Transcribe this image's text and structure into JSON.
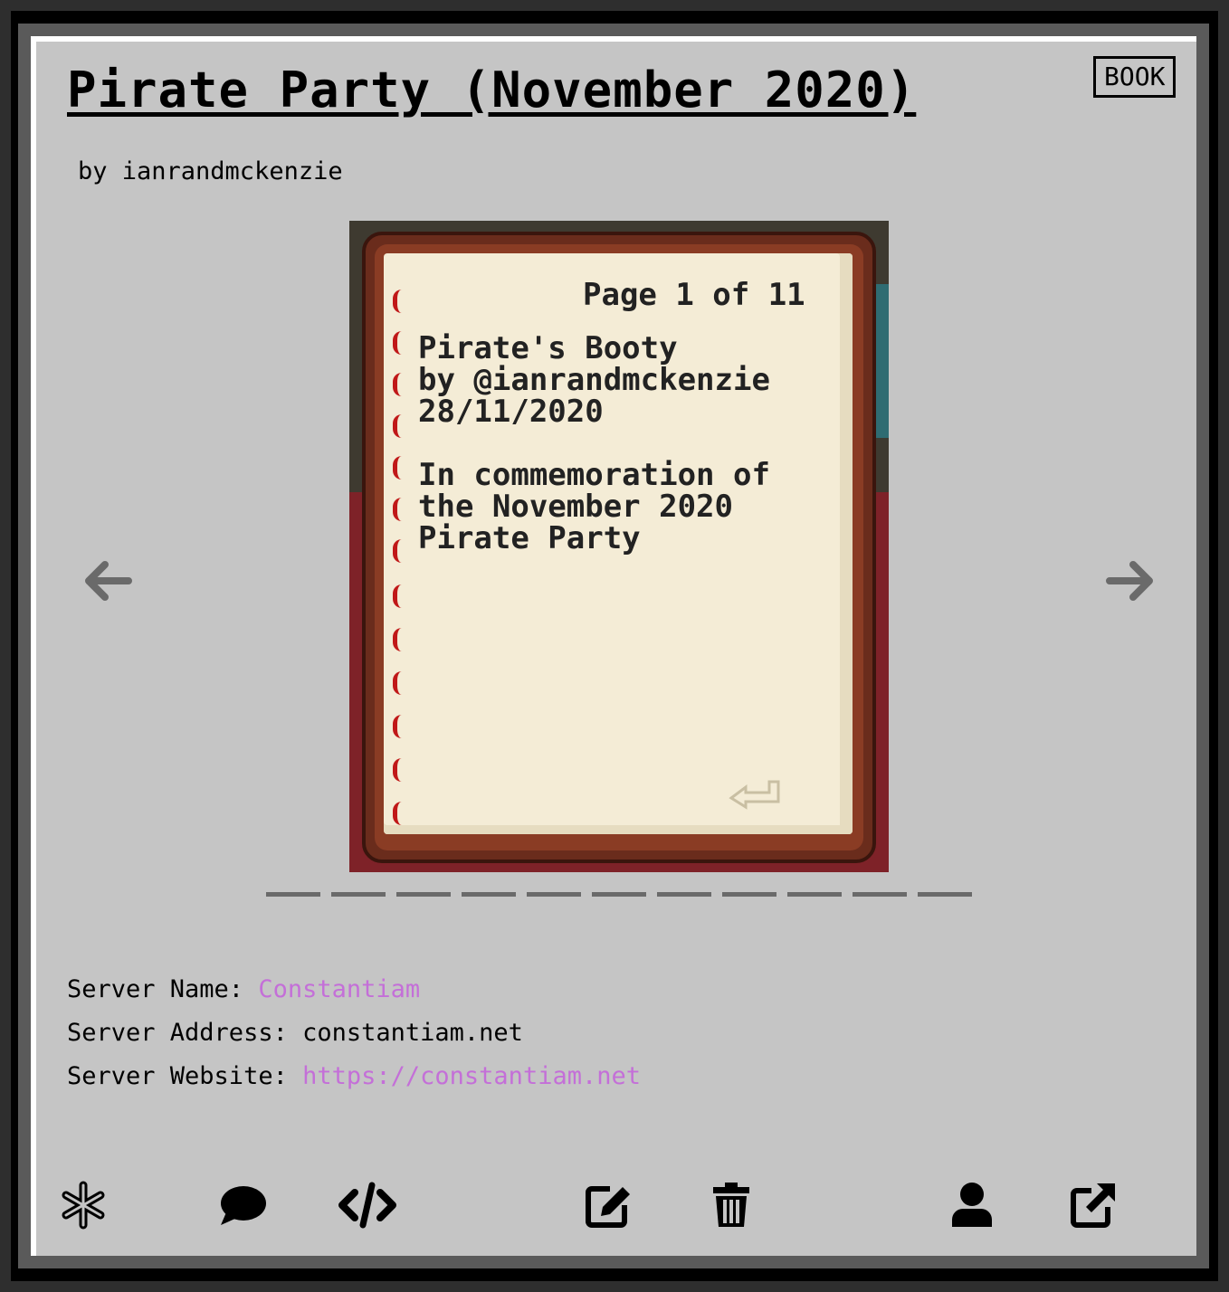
{
  "entry": {
    "title": "Pirate Party (November 2020)",
    "type_badge": "BOOK",
    "author_line": "by ianrandmckenzie"
  },
  "book_page": {
    "page_indicator": "Page 1 of 11",
    "text": "Pirate's Booty\nby @ianrandmckenzie\n28/11/2020\n\nIn commemoration of\nthe November 2020\nPirate Party"
  },
  "carousel": {
    "page_count": 11,
    "current_page": 1
  },
  "server": {
    "name_label": "Server Name:",
    "name_value": "Constantiam",
    "address_label": "Server Address:",
    "address_value": "constantiam.net",
    "website_label": "Server Website:",
    "website_value": "https://constantiam.net"
  },
  "icons": {
    "prev": "arrow-left-icon",
    "next": "arrow-right-icon",
    "actions": [
      "asterisk-icon",
      "comment-icon",
      "code-icon",
      "edit-icon",
      "trash-icon",
      "user-icon",
      "external-link-icon"
    ]
  },
  "colors": {
    "card_background": "#c5c5c5",
    "link": "#c46fd8",
    "arrow": "#6a6a6a",
    "page_dot": "#6a6a6a"
  }
}
